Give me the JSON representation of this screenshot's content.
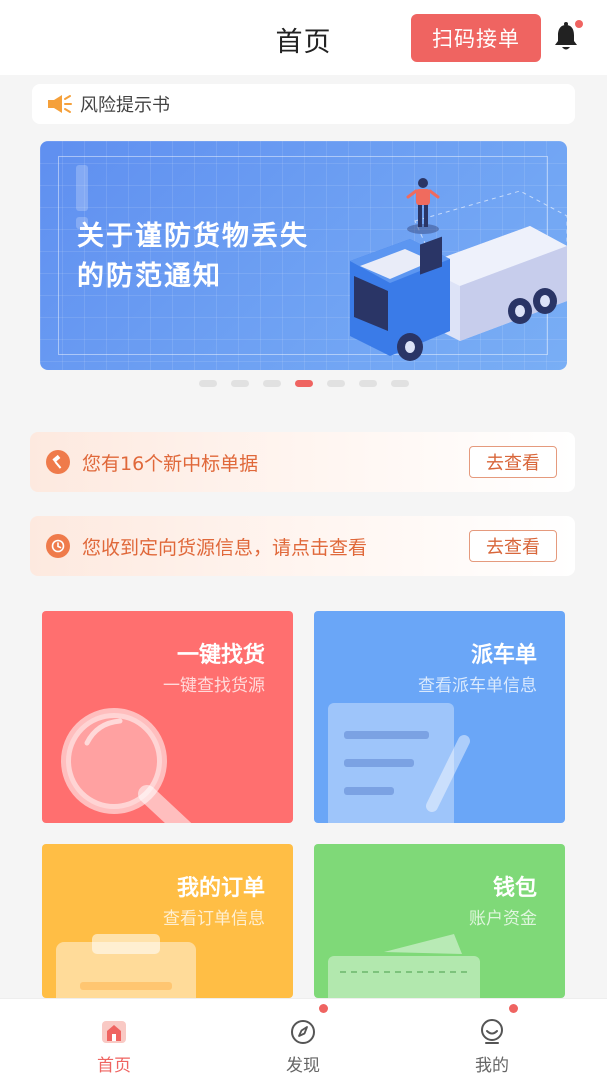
{
  "header": {
    "title": "首页",
    "scan_button": "扫码接单"
  },
  "risk_notice": {
    "label": "风险提示书"
  },
  "banner": {
    "headline_line1": "关于谨防货物丢失",
    "headline_line2": "的防范通知",
    "slide_count": 7,
    "active_slide": 4
  },
  "notices": [
    {
      "text": "您有16个新中标单据",
      "button": "去查看"
    },
    {
      "text": "您收到定向货源信息，请点击查看",
      "button": "去查看"
    }
  ],
  "cards": [
    {
      "title": "一键找货",
      "subtitle": "一键查找货源",
      "color": "#ff6f6f"
    },
    {
      "title": "派车单",
      "subtitle": "查看派车单信息",
      "color": "#6aa6f7"
    },
    {
      "title": "我的订单",
      "subtitle": "查看订单信息",
      "color": "#ffbe45"
    },
    {
      "title": "钱包",
      "subtitle": "账户资金",
      "color": "#7fd978"
    }
  ],
  "tabbar": {
    "items": [
      {
        "label": "首页",
        "icon": "home-icon",
        "active": true
      },
      {
        "label": "发现",
        "icon": "compass-icon",
        "active": false
      },
      {
        "label": "我的",
        "icon": "profile-icon",
        "active": false
      }
    ]
  },
  "colors": {
    "accent": "#ef6461",
    "notice_text": "#e0683a"
  }
}
